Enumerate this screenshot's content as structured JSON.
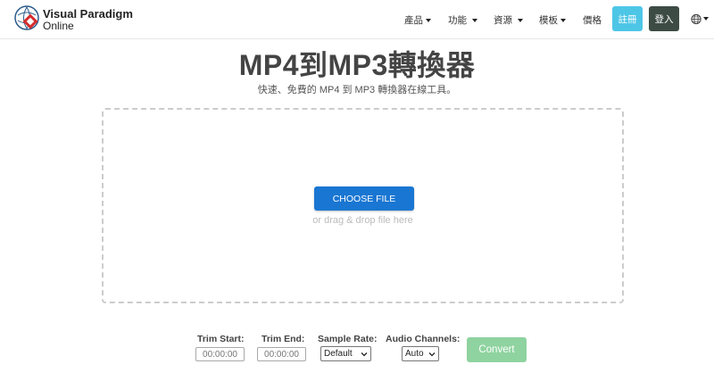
{
  "header": {
    "logo_line1": "Visual Paradigm",
    "logo_line2": "Online",
    "nav": [
      {
        "label": "產品",
        "has_caret": true
      },
      {
        "label": "功能",
        "has_caret": true
      },
      {
        "label": "資源",
        "has_caret": true
      },
      {
        "label": "模板",
        "has_caret": true
      },
      {
        "label": "價格",
        "has_caret": false
      }
    ],
    "register_label": "註冊",
    "login_label": "登入",
    "language_icon": "globe-icon"
  },
  "main": {
    "title": "MP4到MP3轉換器",
    "subtitle": "快速、免費的 MP4 到 MP3 轉換器在線工具。",
    "choose_file_label": "CHOOSE FILE",
    "drag_drop_text": "or drag & drop file here"
  },
  "options": {
    "trim_start_label": "Trim Start:",
    "trim_start_value": "00:00:00",
    "trim_end_label": "Trim End:",
    "trim_end_value": "00:00:00",
    "sample_rate_label": "Sample Rate:",
    "sample_rate_value": "Default",
    "audio_channels_label": "Audio Channels:",
    "audio_channels_value": "Auto",
    "convert_label": "Convert"
  },
  "colors": {
    "register_bg": "#4dc6e6",
    "login_bg": "#3d4b45",
    "choose_file_bg": "#1976d2",
    "convert_bg": "#8fd3a0"
  }
}
